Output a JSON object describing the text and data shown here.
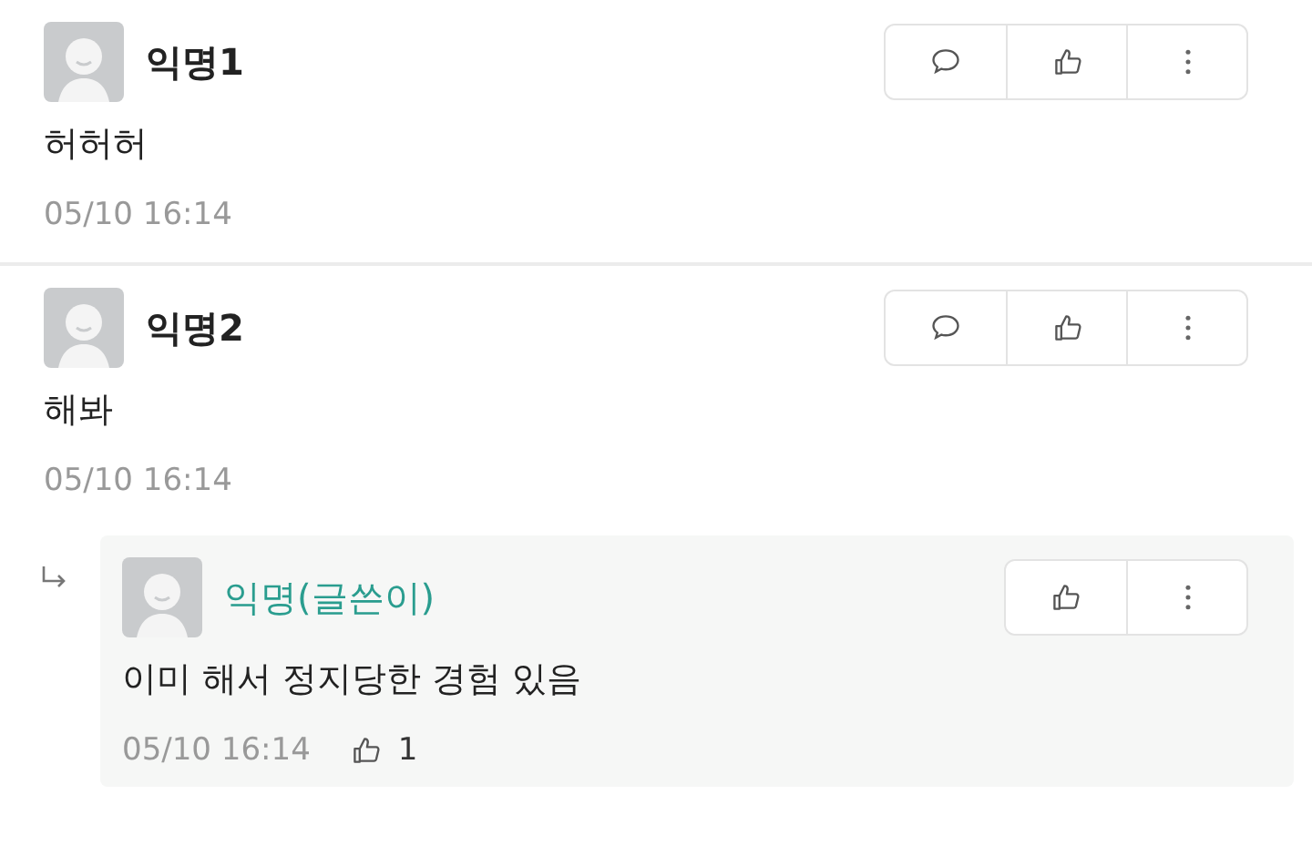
{
  "comments": [
    {
      "kind": "comment",
      "author": "익명1",
      "is_writer": false,
      "body": "허허허",
      "date": "05/10 16:14",
      "actions": [
        {
          "kind": "reply"
        },
        {
          "kind": "like"
        },
        {
          "kind": "more"
        }
      ]
    },
    {
      "kind": "comment",
      "author": "익명2",
      "is_writer": false,
      "body": "해봐",
      "date": "05/10 16:14",
      "actions": [
        {
          "kind": "reply"
        },
        {
          "kind": "like"
        },
        {
          "kind": "more"
        }
      ]
    },
    {
      "kind": "reply",
      "author": "익명(글쓴이)",
      "is_writer": true,
      "body": "이미 해서 정지당한 경험 있음",
      "date": "05/10 16:14",
      "like_count": "1",
      "actions": [
        {
          "kind": "like"
        },
        {
          "kind": "more"
        }
      ]
    }
  ]
}
